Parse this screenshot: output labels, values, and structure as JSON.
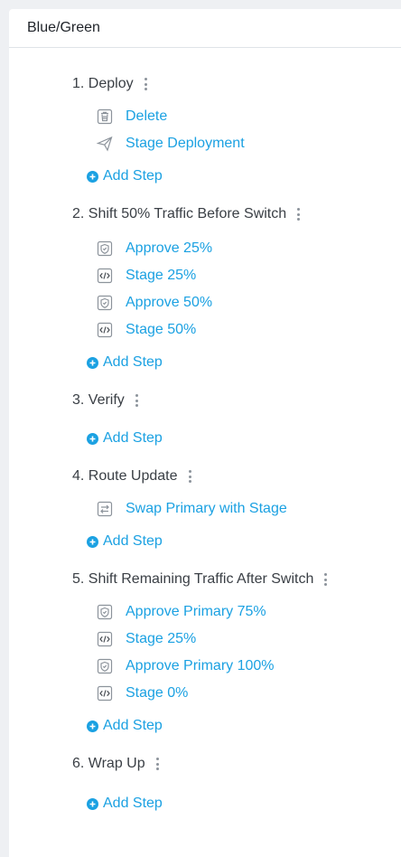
{
  "header": {
    "title": "Blue/Green"
  },
  "add_step_label": "Add Step",
  "phases": [
    {
      "title": "1. Deploy",
      "steps": [
        {
          "label": "Delete",
          "icon": "trash-icon"
        },
        {
          "label": "Stage Deployment",
          "icon": "paper-plane-icon"
        }
      ]
    },
    {
      "title": "2. Shift 50% Traffic Before Switch",
      "steps": [
        {
          "label": "Approve 25%",
          "icon": "approval-shield-icon"
        },
        {
          "label": "Stage 25%",
          "icon": "code-icon"
        },
        {
          "label": "Approve 50%",
          "icon": "approval-shield-icon"
        },
        {
          "label": "Stage 50%",
          "icon": "code-icon"
        }
      ]
    },
    {
      "title": "3. Verify",
      "steps": []
    },
    {
      "title": "4. Route Update",
      "steps": [
        {
          "label": "Swap Primary with Stage",
          "icon": "swap-arrows-icon"
        }
      ]
    },
    {
      "title": "5. Shift Remaining Traffic After Switch",
      "steps": [
        {
          "label": "Approve Primary 75%",
          "icon": "approval-shield-icon"
        },
        {
          "label": "Stage 25%",
          "icon": "code-icon"
        },
        {
          "label": "Approve Primary 100%",
          "icon": "approval-shield-icon"
        },
        {
          "label": "Stage 0%",
          "icon": "code-icon"
        }
      ]
    },
    {
      "title": "6. Wrap Up",
      "steps": []
    }
  ],
  "colors": {
    "link": "#1ba1e2",
    "icon_gray": "#8c939b",
    "title_text": "#3a3f45",
    "background": "#eef0f3"
  }
}
